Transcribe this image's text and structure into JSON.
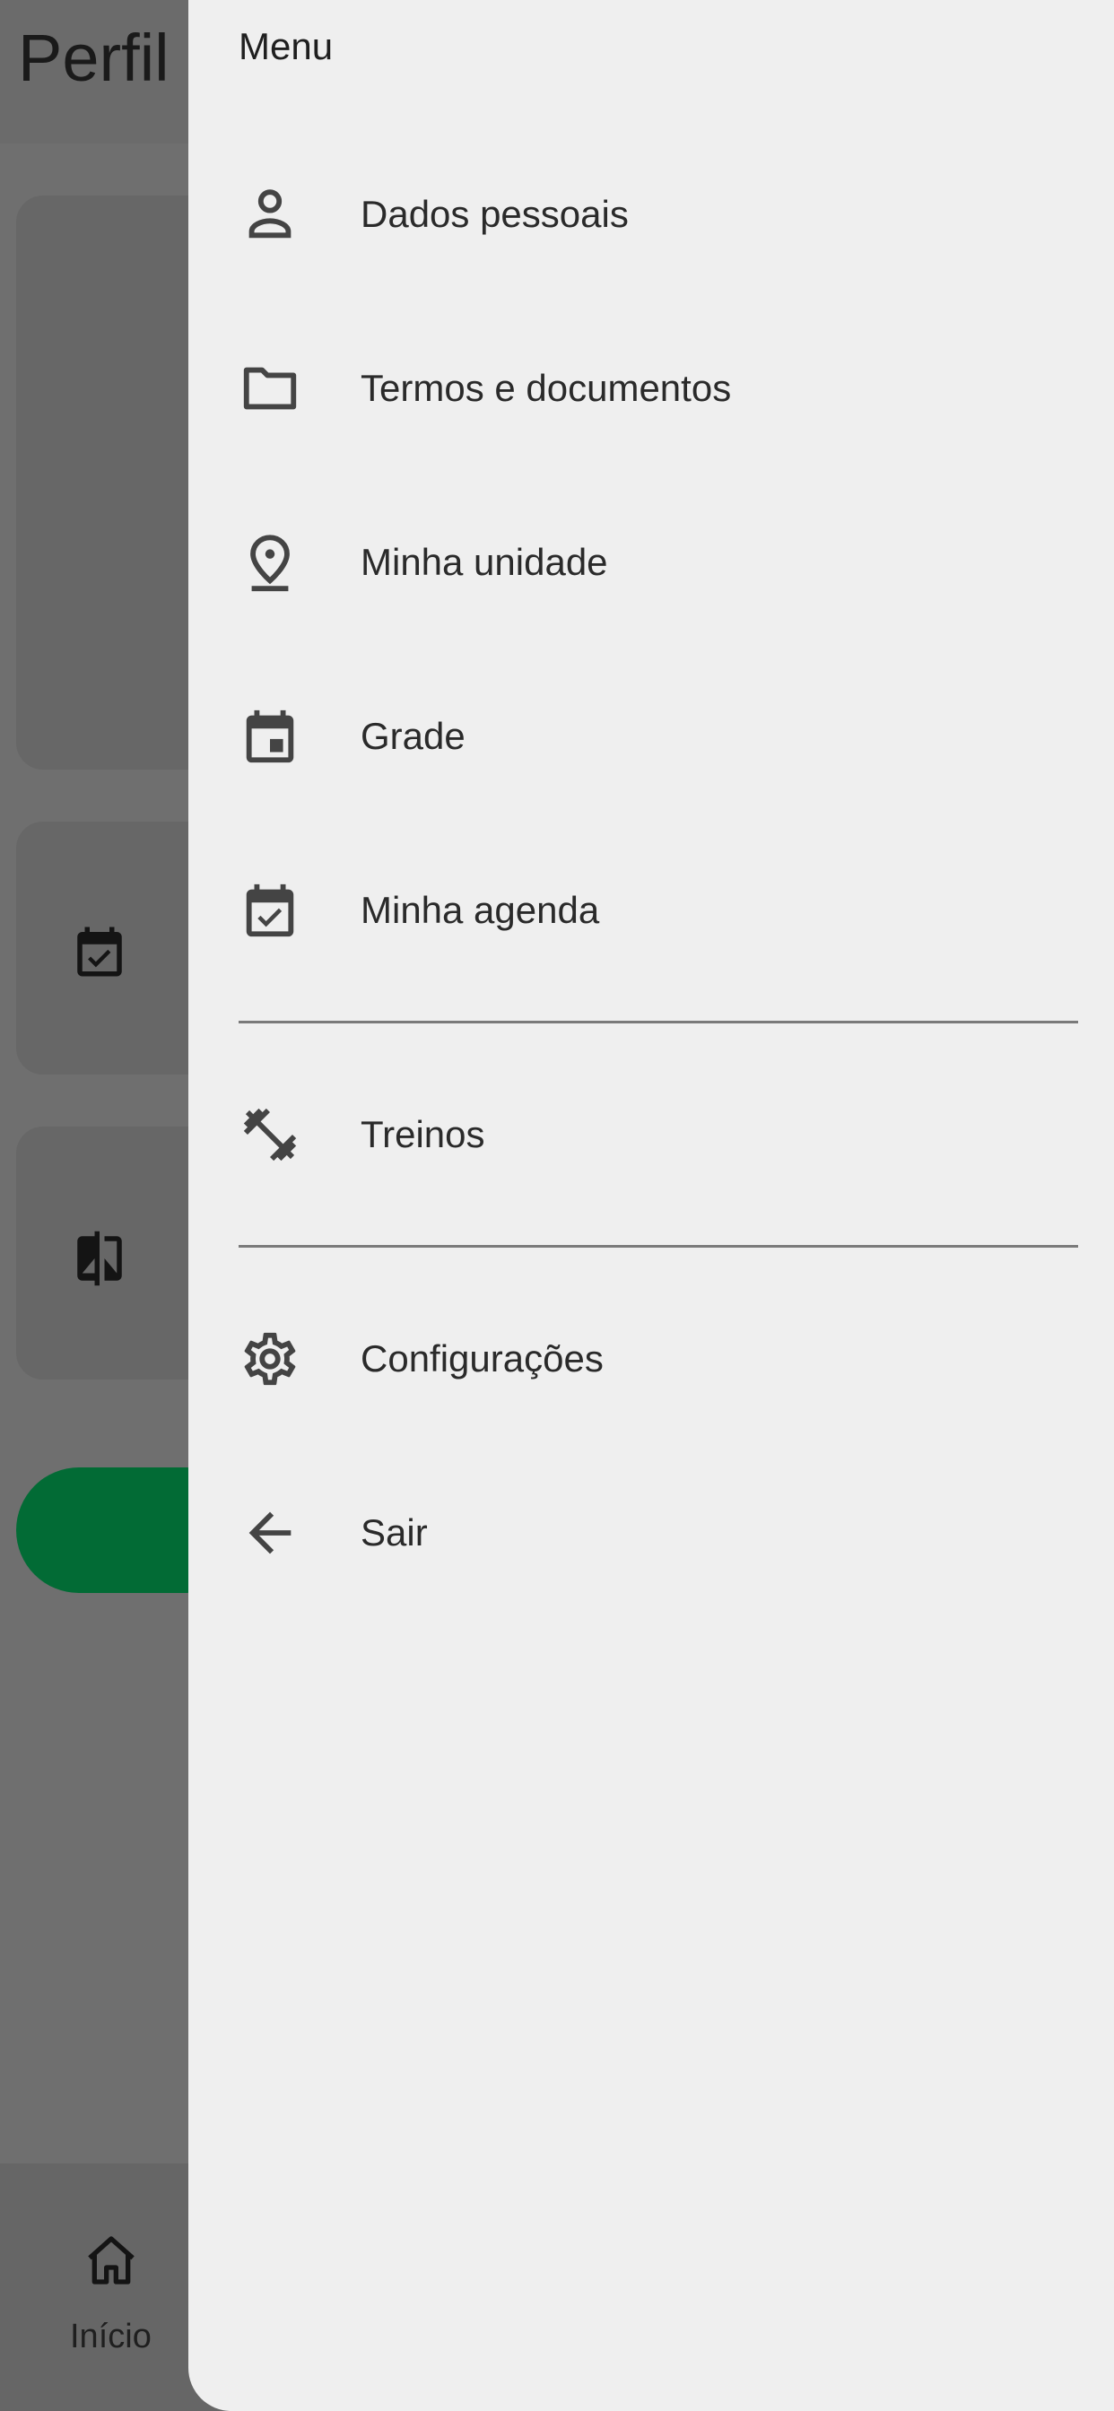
{
  "background": {
    "page_title": "Perfil",
    "bottom_nav": {
      "home_label": "Início"
    },
    "accent_color": "#026b35"
  },
  "drawer": {
    "title": "Menu",
    "items": [
      {
        "label": "Dados pessoais",
        "icon": "person-icon"
      },
      {
        "label": "Termos e documentos",
        "icon": "folder-icon"
      },
      {
        "label": "Minha unidade",
        "icon": "location-pin-icon"
      },
      {
        "label": "Grade",
        "icon": "calendar-icon"
      },
      {
        "label": "Minha agenda",
        "icon": "calendar-check-icon"
      },
      {
        "label": "Treinos",
        "icon": "dumbbell-icon"
      },
      {
        "label": "Configurações",
        "icon": "gear-icon"
      },
      {
        "label": "Sair",
        "icon": "arrow-back-icon"
      }
    ]
  }
}
